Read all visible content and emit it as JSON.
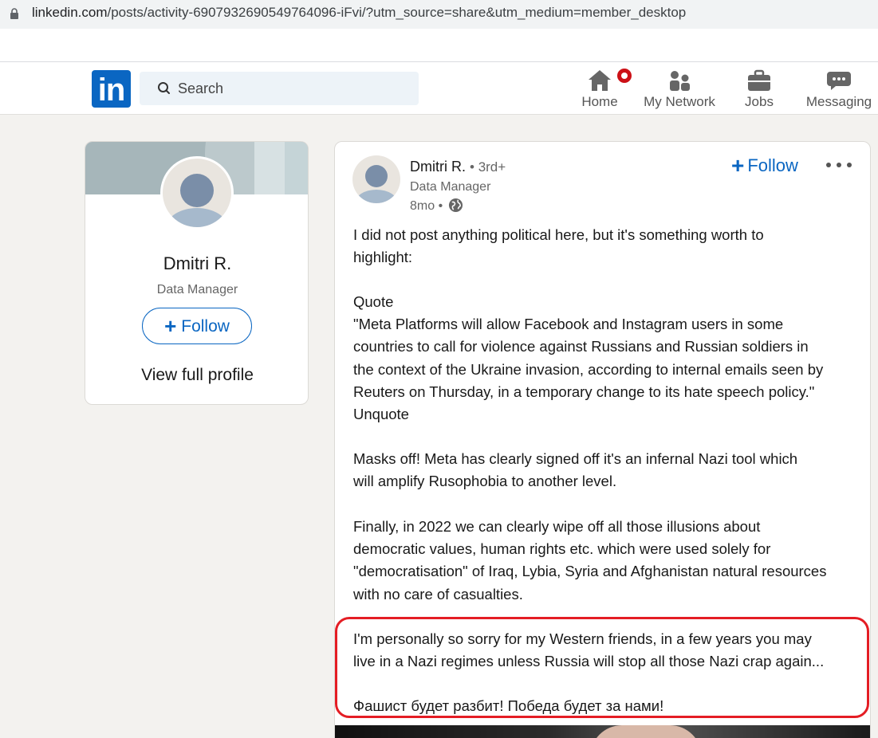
{
  "browser": {
    "url_host": "linkedin.com",
    "url_path": "/posts/activity-6907932690549764096-iFvi/?utm_source=share&utm_medium=member_desktop"
  },
  "nav": {
    "logo": "in",
    "search_placeholder": "Search",
    "items": [
      {
        "label": "Home",
        "icon": "home-icon"
      },
      {
        "label": "My Network",
        "icon": "network-icon"
      },
      {
        "label": "Jobs",
        "icon": "briefcase-icon"
      },
      {
        "label": "Messaging",
        "icon": "messaging-icon"
      }
    ],
    "accent": "#0a66c2",
    "badge_color": "#cc1016"
  },
  "profile_card": {
    "name": "Dmitri R.",
    "title": "Data Manager",
    "follow_label": "Follow",
    "view_profile_label": "View full profile"
  },
  "post": {
    "author": "Dmitri R.",
    "degree": "• 3rd+",
    "author_title": "Data Manager",
    "time": "8mo •",
    "follow_label": "Follow",
    "paragraphs": [
      "I did not post anything political here, but it's something worth to\nhighlight:",
      "Quote\n\"Meta Platforms will allow Facebook and Instagram users in some\ncountries to call for violence against Russians and Russian soldiers in\nthe context of the Ukraine invasion, according to internal emails seen by\nReuters on Thursday, in a temporary change to its hate speech policy.\"\nUnquote",
      "Masks off! Meta has clearly signed off it's an infernal Nazi tool which\nwill amplify Rusophobia to another level.",
      "Finally, in 2022 we can clearly wipe off all those illusions about\ndemocratic values, human rights etc. which were used solely for\n\"democratisation\" of Iraq, Lybia, Syria and Afghanistan natural resources\nwith no care of casualties.",
      "I'm personally so sorry for my Western friends, in a few years you may\nlive in a Nazi regimes unless Russia will stop all those Nazi crap again...",
      "Фашист будет разбит! Победа будет за нами!"
    ],
    "highlight_color": "#e41d24"
  }
}
